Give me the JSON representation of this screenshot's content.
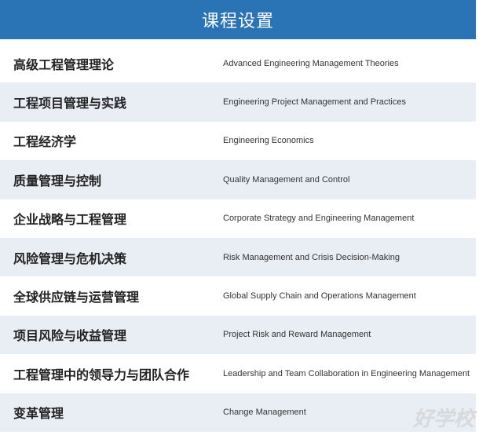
{
  "header": {
    "title": "课程设置"
  },
  "courses": [
    {
      "cn": "高级工程管理理论",
      "en": "Advanced Engineering Management Theories"
    },
    {
      "cn": "工程项目管理与实践",
      "en": "Engineering Project Management and Practices"
    },
    {
      "cn": "工程经济学",
      "en": "Engineering Economics"
    },
    {
      "cn": "质量管理与控制",
      "en": "Quality Management and Control"
    },
    {
      "cn": "企业战略与工程管理",
      "en": "Corporate Strategy and Engineering Management"
    },
    {
      "cn": "风险管理与危机决策",
      "en": "Risk Management and Crisis Decision-Making"
    },
    {
      "cn": "全球供应链与运营管理",
      "en": "Global Supply Chain and Operations Management"
    },
    {
      "cn": "项目风险与收益管理",
      "en": "Project Risk and Reward Management"
    },
    {
      "cn": "工程管理中的领导力与团队合作",
      "en": "Leadership and Team Collaboration in Engineering Management"
    },
    {
      "cn": "变革管理",
      "en": "Change Management"
    }
  ],
  "watermark": {
    "text": "好学校"
  },
  "colors": {
    "header_bg": "#2a73b4",
    "alt_row_bg": "#e8eef4"
  }
}
